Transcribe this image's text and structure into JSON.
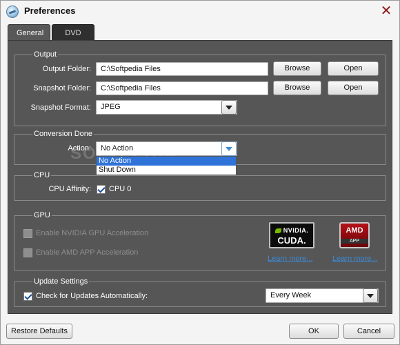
{
  "window": {
    "title": "Preferences",
    "close_glyph": "✕"
  },
  "tabs": [
    {
      "label": "General",
      "active": true
    },
    {
      "label": "DVD",
      "active": false
    }
  ],
  "output": {
    "group_title": "Output",
    "output_folder_label": "Output Folder:",
    "output_folder_value": "C:\\Softpedia Files",
    "snapshot_folder_label": "Snapshot Folder:",
    "snapshot_folder_value": "C:\\Softpedia Files",
    "browse_label": "Browse",
    "open_label": "Open",
    "snapshot_format_label": "Snapshot Format:",
    "snapshot_format_value": "JPEG"
  },
  "conversion": {
    "group_title": "Conversion Done",
    "action_label": "Action:",
    "action_value": "No Action",
    "options": [
      "No Action",
      "Shut Down"
    ]
  },
  "cpu": {
    "group_title": "CPU",
    "affinity_label": "CPU Affinity:",
    "cpu0_label": "CPU 0",
    "cpu0_checked": true
  },
  "gpu": {
    "group_title": "GPU",
    "nvidia_label": "Enable NVIDIA GPU Acceleration",
    "amd_label": "Enable AMD APP Acceleration",
    "nvidia_logo_brand": "NVIDIA.",
    "nvidia_logo_product": "CUDA.",
    "amd_logo_brand": "AMD",
    "amd_logo_product": "APP",
    "learn_more_label": "Learn more..."
  },
  "update": {
    "group_title": "Update Settings",
    "check_label": "Check for Updates Automatically:",
    "check_checked": true,
    "frequency_value": "Every Week"
  },
  "footer": {
    "restore_label": "Restore Defaults",
    "ok_label": "OK",
    "cancel_label": "Cancel"
  },
  "watermark": "SOFTPEDIA",
  "colors": {
    "panel_bg": "#565656",
    "tab_active": "#585858",
    "tab_inactive": "#2f2f2f",
    "link": "#3c8bd9",
    "selection": "#2f73d9"
  }
}
